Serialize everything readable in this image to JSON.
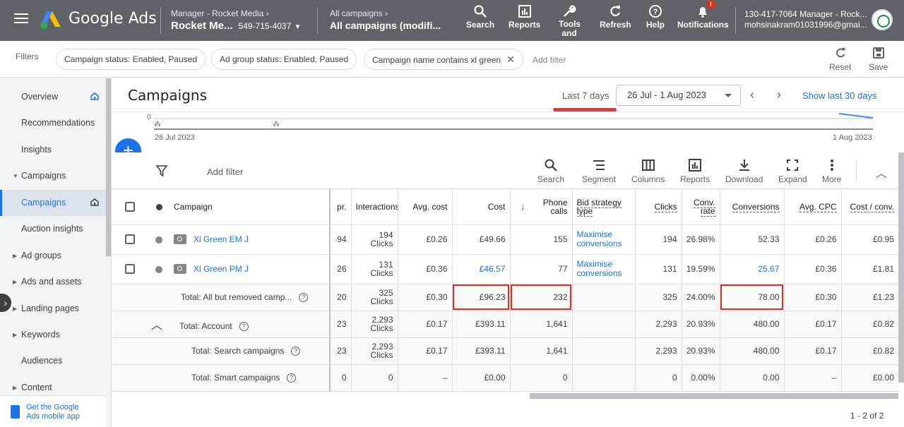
{
  "topbar": {
    "brand": "Google Ads",
    "manager_line": "Manager - Rocket Media",
    "account_name": "Rocket Me...",
    "account_id": "549-715-4037",
    "campaigns_line": "All campaigns",
    "campaigns_name": "All campaigns (modifi...",
    "buttons": {
      "search": "Search",
      "reports": "Reports",
      "tools": "Tools and",
      "refresh": "Refresh",
      "help": "Help",
      "notifications": "Notifications"
    },
    "notification_badge": "!",
    "user_line1": "130-417-7064 Manager - Rock...",
    "user_line2": "mohsinakram01031996@gmai..."
  },
  "filterbar": {
    "label": "Filters",
    "chips": [
      "Campaign status: Enabled, Paused",
      "Ad group status: Enabled, Paused",
      "Campaign name contains xl green"
    ],
    "add_filter": "Add filter",
    "reset": "Reset",
    "save": "Save"
  },
  "sidebar": {
    "items": [
      {
        "label": "Overview"
      },
      {
        "label": "Recommendations"
      },
      {
        "label": "Insights"
      },
      {
        "label": "Campaigns"
      },
      {
        "label": "Campaigns"
      },
      {
        "label": "Auction insights"
      },
      {
        "label": "Ad groups"
      },
      {
        "label": "Ads and assets"
      },
      {
        "label": "Landing pages"
      },
      {
        "label": "Keywords"
      },
      {
        "label": "Audiences"
      },
      {
        "label": "Content"
      }
    ],
    "mobile_app": "Get the Google Ads mobile app"
  },
  "main": {
    "title": "Campaigns",
    "date_label": "Last 7 days",
    "date_range": "26 Jul - 1 Aug 2023",
    "show_30": "Show last 30 days",
    "chart_zero": "0",
    "chart_start": "26 Jul 2023",
    "chart_end": "1 Aug 2023"
  },
  "toolbar": {
    "add_filter": "Add filter",
    "tools": {
      "search": "Search",
      "segment": "Segment",
      "columns": "Columns",
      "reports": "Reports",
      "download": "Download",
      "expand": "Expand",
      "more": "More"
    }
  },
  "table": {
    "headers": {
      "campaign": "Campaign",
      "impr": "pr.",
      "interactions": "Interactions",
      "avg_cost": "Avg. cost",
      "cost": "Cost",
      "phone_calls_1": "Phone",
      "phone_calls_2": "calls",
      "bid_1": "Bid strategy",
      "bid_2": "type",
      "clicks": "Clicks",
      "conv_rate_1": "Conv.",
      "conv_rate_2": "rate",
      "conversions": "Conversions",
      "avg_cpc": "Avg. CPC",
      "cost_conv": "Cost / conv."
    },
    "rows": [
      {
        "name": "Xl Green EM J",
        "impr": "94",
        "interactions": "194",
        "int_unit": "Clicks",
        "avg_cost": "£0.26",
        "cost": "£49.66",
        "calls": "155",
        "bid1": "Maximise",
        "bid2": "conversions",
        "clicks": "194",
        "conv_rate": "26.98%",
        "conversions": "52.33",
        "avg_cpc": "£0.26",
        "cost_conv": "£0.95"
      },
      {
        "name": "Xl Green PM J",
        "impr": "26",
        "interactions": "131",
        "int_unit": "Clicks",
        "avg_cost": "£0.36",
        "cost": "£46.57",
        "calls": "77",
        "bid1": "Maximise",
        "bid2": "conversions",
        "clicks": "131",
        "conv_rate": "19.59%",
        "conversions": "25.67",
        "avg_cpc": "£0.36",
        "cost_conv": "£1.81"
      }
    ],
    "totals": [
      {
        "name": "Total: All but removed camp...",
        "impr": "20",
        "interactions": "325",
        "int_unit": "Clicks",
        "avg_cost": "£0.30",
        "cost": "£96.23",
        "calls": "232",
        "clicks": "325",
        "conv_rate": "24.00%",
        "conversions": "78.00",
        "avg_cpc": "£0.30",
        "cost_conv": "£1.23"
      },
      {
        "name": "Total: Account",
        "impr": "23",
        "interactions": "2,293",
        "int_unit": "Clicks",
        "avg_cost": "£0.17",
        "cost": "£393.11",
        "calls": "1,641",
        "clicks": "2,293",
        "conv_rate": "20.93%",
        "conversions": "480.00",
        "avg_cpc": "£0.17",
        "cost_conv": "£0.82"
      },
      {
        "name": "Total: Search campaigns",
        "impr": "23",
        "interactions": "2,293",
        "int_unit": "Clicks",
        "avg_cost": "£0.17",
        "cost": "£393.11",
        "calls": "1,641",
        "clicks": "2,293",
        "conv_rate": "20.93%",
        "conversions": "480.00",
        "avg_cpc": "£0.17",
        "cost_conv": "£0.82"
      },
      {
        "name": "Total: Smart campaigns",
        "impr": "0",
        "interactions": "0",
        "avg_cost": "–",
        "cost": "£0.00",
        "calls": "0",
        "clicks": "0",
        "conv_rate": "0.00%",
        "conversions": "0.00",
        "avg_cpc": "–",
        "cost_conv": "£0.00"
      }
    ],
    "pager": "1 - 2 of 2"
  }
}
